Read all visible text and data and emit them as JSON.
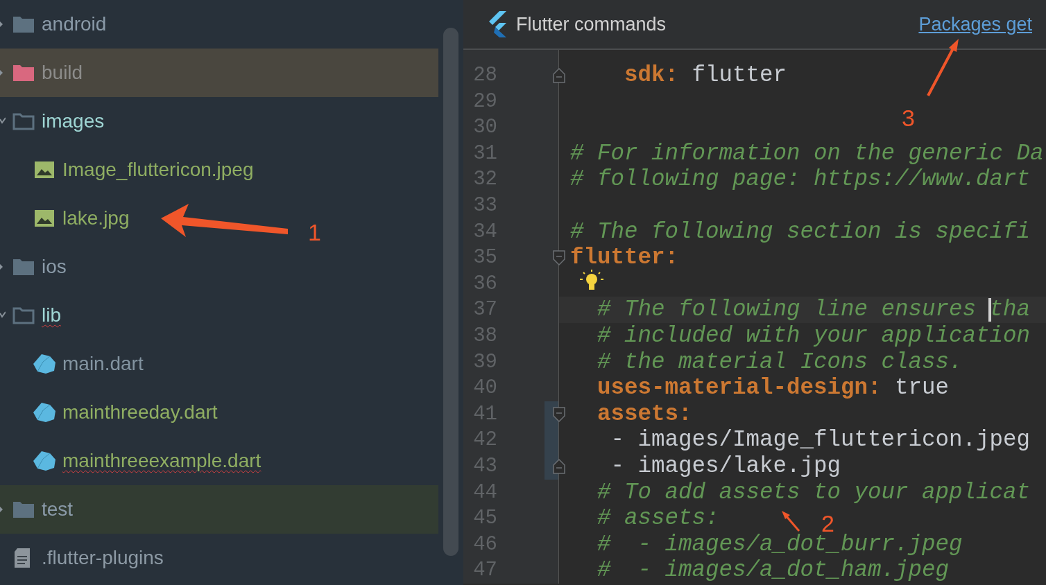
{
  "project_tree": [
    {
      "label": "android",
      "kind": "folder",
      "expanded": false,
      "color": "#8a9aa8",
      "error": false
    },
    {
      "label": "build",
      "kind": "excluded_folder",
      "expanded": false,
      "color": "#8c8c8a",
      "error": false
    },
    {
      "label": "images",
      "kind": "folder",
      "expanded": true,
      "color": "#9fd6d4",
      "error": false,
      "children": [
        {
          "label": "Image_fluttericon.jpeg",
          "kind": "image",
          "color": "#8fae62",
          "error": false
        },
        {
          "label": "lake.jpg",
          "kind": "image",
          "color": "#8fae62",
          "error": false
        }
      ]
    },
    {
      "label": "ios",
      "kind": "folder",
      "expanded": false,
      "color": "#8a9aa8",
      "error": false
    },
    {
      "label": "lib",
      "kind": "folder",
      "expanded": true,
      "color": "#9fd6d4",
      "error": true,
      "children": [
        {
          "label": "main.dart",
          "kind": "dart",
          "color": "#8394a1",
          "error": false
        },
        {
          "label": "mainthreeday.dart",
          "kind": "dart",
          "color": "#8fae62",
          "error": false
        },
        {
          "label": "mainthreeexample.dart",
          "kind": "dart",
          "color": "#8fae62",
          "error": true
        }
      ]
    },
    {
      "label": "test",
      "kind": "test_folder",
      "expanded": false,
      "color": "#8a9aa8",
      "error": false
    },
    {
      "label": ".flutter-plugins",
      "kind": "file",
      "color": "#8d9aa5",
      "error": false
    }
  ],
  "editor": {
    "banner": {
      "title": "Flutter commands",
      "link": "Packages get"
    },
    "lines": [
      {
        "number": "28",
        "fold_start": false,
        "fold_end": true,
        "current": false,
        "bulb": false,
        "change_mark": false,
        "parts": [
          {
            "kind": "key",
            "text": "    sdk:"
          },
          {
            "kind": "value",
            "text": " flutter"
          }
        ]
      },
      {
        "number": "29",
        "fold_start": false,
        "fold_end": false,
        "current": false,
        "bulb": false,
        "change_mark": false
      },
      {
        "number": "30",
        "fold_start": false,
        "fold_end": false,
        "current": false,
        "bulb": false,
        "change_mark": false
      },
      {
        "number": "31",
        "fold_start": false,
        "fold_end": false,
        "current": false,
        "bulb": false,
        "change_mark": false,
        "parts": [
          {
            "kind": "comment",
            "text": "# For information on the generic Da"
          }
        ]
      },
      {
        "number": "32",
        "fold_start": false,
        "fold_end": false,
        "current": false,
        "bulb": false,
        "change_mark": false,
        "parts": [
          {
            "kind": "comment",
            "text": "# following page: https://www.dart"
          }
        ]
      },
      {
        "number": "33",
        "fold_start": false,
        "fold_end": false,
        "current": false,
        "bulb": false,
        "change_mark": false
      },
      {
        "number": "34",
        "fold_start": false,
        "fold_end": false,
        "current": false,
        "bulb": false,
        "change_mark": false,
        "parts": [
          {
            "kind": "comment",
            "text": "# The following section is specifi"
          }
        ]
      },
      {
        "number": "35",
        "fold_start": true,
        "fold_end": false,
        "current": false,
        "bulb": false,
        "change_mark": false,
        "parts": [
          {
            "kind": "key",
            "text": "flutter:"
          }
        ]
      },
      {
        "number": "36",
        "fold_start": false,
        "fold_end": false,
        "current": false,
        "bulb": true,
        "change_mark": false
      },
      {
        "number": "37",
        "fold_start": false,
        "fold_end": false,
        "current": true,
        "bulb": false,
        "change_mark": false,
        "parts": [
          {
            "kind": "comment",
            "text": "  # The following line ensures "
          },
          {
            "kind": "caret"
          },
          {
            "kind": "comment",
            "text": "tha"
          }
        ]
      },
      {
        "number": "38",
        "fold_start": false,
        "fold_end": false,
        "current": false,
        "bulb": false,
        "change_mark": false,
        "parts": [
          {
            "kind": "comment",
            "text": "  # included with your application"
          }
        ]
      },
      {
        "number": "39",
        "fold_start": false,
        "fold_end": false,
        "current": false,
        "bulb": false,
        "change_mark": false,
        "parts": [
          {
            "kind": "comment",
            "text": "  # the material Icons class."
          }
        ]
      },
      {
        "number": "40",
        "fold_start": false,
        "fold_end": false,
        "current": false,
        "bulb": false,
        "change_mark": false,
        "parts": [
          {
            "kind": "key",
            "text": "  uses-material-design:"
          },
          {
            "kind": "value",
            "text": " true"
          }
        ]
      },
      {
        "number": "41",
        "fold_start": true,
        "fold_end": false,
        "current": false,
        "bulb": false,
        "change_mark": true,
        "parts": [
          {
            "kind": "key",
            "text": "  assets:"
          }
        ]
      },
      {
        "number": "42",
        "fold_start": false,
        "fold_end": false,
        "current": false,
        "bulb": false,
        "change_mark": true,
        "parts": [
          {
            "kind": "value",
            "text": "   - images/Image_fluttericon.jpeg"
          }
        ]
      },
      {
        "number": "43",
        "fold_start": false,
        "fold_end": true,
        "current": false,
        "bulb": false,
        "change_mark": true,
        "parts": [
          {
            "kind": "value",
            "text": "   - images/lake.jpg"
          }
        ]
      },
      {
        "number": "44",
        "fold_start": false,
        "fold_end": false,
        "current": false,
        "bulb": false,
        "change_mark": false,
        "parts": [
          {
            "kind": "comment",
            "text": "  # To add assets to your applicat"
          }
        ]
      },
      {
        "number": "45",
        "fold_start": false,
        "fold_end": false,
        "current": false,
        "bulb": false,
        "change_mark": false,
        "parts": [
          {
            "kind": "comment",
            "text": "  # assets:"
          }
        ]
      },
      {
        "number": "46",
        "fold_start": false,
        "fold_end": false,
        "current": false,
        "bulb": false,
        "change_mark": false,
        "parts": [
          {
            "kind": "comment",
            "text": "  #  - images/a_dot_burr.jpeg"
          }
        ]
      },
      {
        "number": "47",
        "fold_start": false,
        "fold_end": false,
        "current": false,
        "bulb": false,
        "change_mark": false,
        "parts": [
          {
            "kind": "comment",
            "text": "  #  - images/a_dot_ham.jpeg"
          }
        ]
      }
    ]
  },
  "annotations": [
    {
      "label": "1"
    },
    {
      "label": "2"
    },
    {
      "label": "3"
    }
  ]
}
